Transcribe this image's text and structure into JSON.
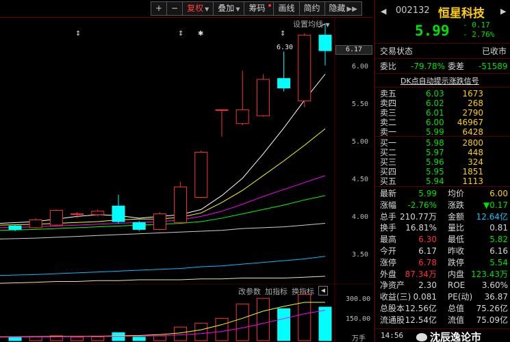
{
  "toolbar": {
    "add": "+",
    "sub": "−",
    "fq": "复权",
    "overlay": "叠加",
    "chip": "筹码",
    "draw": "画线",
    "f10": "简约",
    "hide": "隐藏"
  },
  "ma_setting": "设置均线",
  "high_label": "6.30",
  "current_price_tag": "6.17",
  "price_axis": [
    "6.00",
    "5.50",
    "5.00",
    "4.50",
    "4.00",
    "3.50"
  ],
  "vol_axis": [
    "300.00",
    "150.00",
    "万手"
  ],
  "markers": [
    "⇕",
    "⇕",
    "✱",
    "⇕"
  ],
  "vol_tabs": {
    "params": "改参数",
    "add": "加指标",
    "switch": "换指标"
  },
  "stock": {
    "code": "002132",
    "name": "恒星科技",
    "price": "5.99",
    "change": "- 0.17",
    "change_pct": "- 2.76%"
  },
  "trade_status": {
    "label": "交易状态",
    "value": "已收市"
  },
  "webi": {
    "label": "委比",
    "value": "-79.78%",
    "diff_label": "委差",
    "diff_value": "-51589"
  },
  "signal": "DK点自动提示涨跌信号",
  "asks": [
    {
      "label": "卖五",
      "price": "6.03",
      "vol": "1673"
    },
    {
      "label": "卖四",
      "price": "6.02",
      "vol": "268"
    },
    {
      "label": "卖三",
      "price": "6.01",
      "vol": "2790"
    },
    {
      "label": "卖二",
      "price": "6.00",
      "vol": "46967"
    },
    {
      "label": "卖一",
      "price": "5.99",
      "vol": "6428"
    }
  ],
  "bids": [
    {
      "label": "买一",
      "price": "5.98",
      "vol": "2800"
    },
    {
      "label": "买二",
      "price": "5.97",
      "vol": "448"
    },
    {
      "label": "买三",
      "price": "5.96",
      "vol": "324"
    },
    {
      "label": "买四",
      "price": "5.95",
      "vol": "1851"
    },
    {
      "label": "买五",
      "price": "5.94",
      "vol": "1113"
    }
  ],
  "stats": [
    {
      "l1": "最新",
      "v1": "5.99",
      "c1": "g",
      "l2": "均价",
      "v2": "6.00",
      "c2": "y"
    },
    {
      "l1": "涨幅",
      "v1": "-2.76%",
      "c1": "g",
      "l2": "涨跌",
      "v2": "▼0.17",
      "c2": "g"
    },
    {
      "l1": "总手",
      "v1": "210.77万",
      "c1": "w",
      "l2": "金额",
      "v2": "12.64亿",
      "c2": "cy"
    },
    {
      "l1": "换手",
      "v1": "16.81%",
      "c1": "w",
      "l2": "量比",
      "v2": "0.81",
      "c2": "w"
    },
    {
      "l1": "最高",
      "v1": "6.30",
      "c1": "r",
      "l2": "最低",
      "v2": "5.82",
      "c2": "g"
    },
    {
      "l1": "今开",
      "v1": "6.17",
      "c1": "w",
      "l2": "昨收",
      "v2": "6.16",
      "c2": "w"
    },
    {
      "l1": "涨停",
      "v1": "6.78",
      "c1": "r",
      "l2": "跌停",
      "v2": "5.54",
      "c2": "g"
    },
    {
      "l1": "外盘",
      "v1": "87.34万",
      "c1": "r",
      "l2": "内盘",
      "v2": "123.43万",
      "c2": "g"
    },
    {
      "l1": "净资产",
      "v1": "2.30",
      "c1": "w",
      "l2": "ROE",
      "v2": "3.60%",
      "c2": "w"
    },
    {
      "l1": "收益(三)",
      "v1": "0.081",
      "c1": "w",
      "l2": "PE(动)",
      "v2": "36.87",
      "c2": "w"
    },
    {
      "l1": "总股本",
      "v1": "12.56亿",
      "c1": "w",
      "l2": "总值",
      "v2": "75.26亿",
      "c2": "w"
    },
    {
      "l1": "流通股",
      "v1": "12.54亿",
      "c1": "w",
      "l2": "流值",
      "v2": "75.09亿",
      "c2": "w"
    }
  ],
  "footer": {
    "time": "14:56",
    "watermark": "沈辰逸论市"
  },
  "chart_data": {
    "type": "candlestick",
    "ylim": [
      3.35,
      6.33
    ],
    "candles": [
      {
        "o": 3.97,
        "c": 3.93,
        "h": 3.99,
        "l": 3.91
      },
      {
        "o": 3.95,
        "c": 4.04,
        "h": 4.06,
        "l": 3.94
      },
      {
        "o": 3.98,
        "c": 4.15,
        "h": 4.16,
        "l": 3.97
      },
      {
        "o": 4.11,
        "c": 4.11,
        "h": 4.13,
        "l": 4.06
      },
      {
        "o": 4.1,
        "c": 4.14,
        "h": 4.16,
        "l": 4.08
      },
      {
        "o": 4.2,
        "c": 4.02,
        "h": 4.33,
        "l": 4.0
      },
      {
        "o": 4.01,
        "c": 3.93,
        "h": 4.03,
        "l": 3.91
      },
      {
        "o": 3.93,
        "c": 4.11,
        "h": 4.13,
        "l": 3.92
      },
      {
        "o": 4.01,
        "c": 4.42,
        "h": 4.48,
        "l": 4.0
      },
      {
        "o": 4.3,
        "c": 4.82,
        "h": 4.84,
        "l": 4.29
      },
      {
        "o": 5.31,
        "c": 5.31,
        "h": 5.31,
        "l": 5.0
      },
      {
        "o": 5.15,
        "c": 5.31,
        "h": 5.76,
        "l": 5.13
      },
      {
        "o": 5.24,
        "c": 5.66,
        "h": 5.72,
        "l": 5.23
      },
      {
        "o": 5.67,
        "c": 5.56,
        "h": 5.98,
        "l": 5.52
      },
      {
        "o": 5.41,
        "c": 6.17,
        "h": 6.19,
        "l": 5.34
      },
      {
        "o": 6.17,
        "c": 5.99,
        "h": 6.3,
        "l": 5.82
      }
    ],
    "ma": [
      {
        "color": "#ffffff",
        "values": [
          4.0,
          4.02,
          4.05,
          4.08,
          4.1,
          4.09,
          4.06,
          4.08,
          4.1,
          4.16,
          4.32,
          4.52,
          4.8,
          5.1,
          5.42,
          5.72
        ]
      },
      {
        "color": "#ffff00",
        "values": [
          3.98,
          3.99,
          4.0,
          4.01,
          4.02,
          4.04,
          4.05,
          4.05,
          4.07,
          4.12,
          4.24,
          4.38,
          4.55,
          4.72,
          4.9,
          5.09
        ]
      },
      {
        "color": "#ff00ff",
        "values": [
          3.95,
          3.96,
          3.97,
          3.98,
          3.99,
          4.0,
          4.01,
          4.02,
          4.04,
          4.08,
          4.14,
          4.22,
          4.31,
          4.39,
          4.47,
          4.55
        ]
      },
      {
        "color": "#00ff00",
        "values": [
          3.92,
          3.93,
          3.94,
          3.95,
          3.96,
          3.97,
          3.98,
          3.99,
          4.0,
          4.02,
          4.06,
          4.11,
          4.16,
          4.21,
          4.27,
          4.32
        ]
      },
      {
        "color": "#d0d0d0",
        "values": [
          3.82,
          3.83,
          3.84,
          3.85,
          3.86,
          3.87,
          3.88,
          3.89,
          3.9,
          3.91,
          3.92,
          3.94,
          3.95,
          3.96,
          3.98,
          4.0
        ]
      },
      {
        "color": "#00bfff",
        "values": [
          3.4,
          3.41,
          3.42,
          3.43,
          3.44,
          3.45,
          3.46,
          3.47,
          3.48,
          3.5,
          3.51,
          3.53,
          3.55,
          3.57,
          3.59,
          3.62
        ]
      },
      {
        "color": "#e8e8a0",
        "values": [
          3.31,
          3.32,
          3.33,
          3.33,
          3.34,
          3.34,
          3.35,
          3.35,
          3.35,
          3.36,
          3.36,
          3.37,
          3.37,
          3.37,
          3.38,
          3.39
        ]
      }
    ],
    "volume": {
      "ylim": [
        0,
        330
      ],
      "values": [
        20,
        25,
        30,
        22,
        24,
        50,
        22,
        30,
        85,
        110,
        140,
        230,
        265,
        200,
        290,
        210
      ],
      "ma": [
        {
          "color": "#ffff00",
          "values": [
            24,
            25,
            26,
            27,
            28,
            30,
            32,
            38,
            48,
            68,
            100,
            140,
            185,
            215,
            240,
            240
          ]
        },
        {
          "color": "#ff00ff",
          "values": [
            22,
            23,
            24,
            25,
            26,
            27,
            28,
            31,
            36,
            44,
            58,
            80,
            108,
            138,
            168,
            190
          ]
        }
      ]
    }
  }
}
